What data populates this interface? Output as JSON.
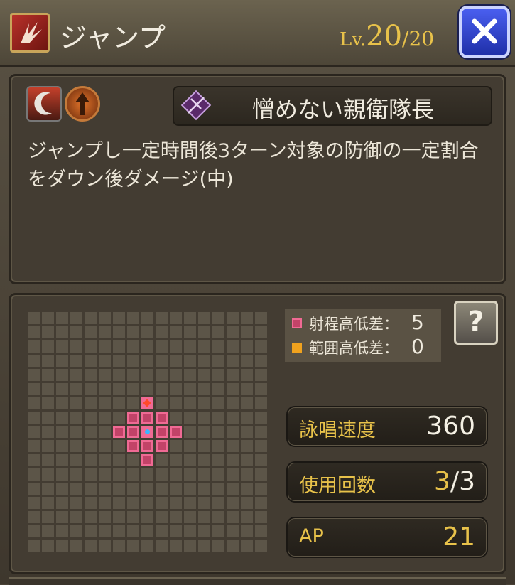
{
  "header": {
    "title": "ジャンプ",
    "level_prefix": "Lv.",
    "level_current": "20",
    "level_max": "/20"
  },
  "job": {
    "name": "憎めない親衛隊長"
  },
  "description": "ジャンプし一定時間後3ターン対象の防御の一定割合をダウン後ダメージ(中)",
  "legend": {
    "range_height_label": "射程高低差：",
    "range_height_value": "5",
    "area_height_label": "範囲高低差：",
    "area_height_value": "0"
  },
  "help_label": "?",
  "stats": {
    "cast_speed_label": "詠唱速度",
    "cast_speed_value": "360",
    "uses_label": "使用回数",
    "uses_current": "3",
    "uses_max": "/3",
    "ap_label": "AP",
    "ap_value": "21"
  },
  "colors": {
    "range": "#f06a94",
    "area": "#f0a21e",
    "accent_gold": "#e8c24a",
    "close_blue": "#2f43d0"
  }
}
